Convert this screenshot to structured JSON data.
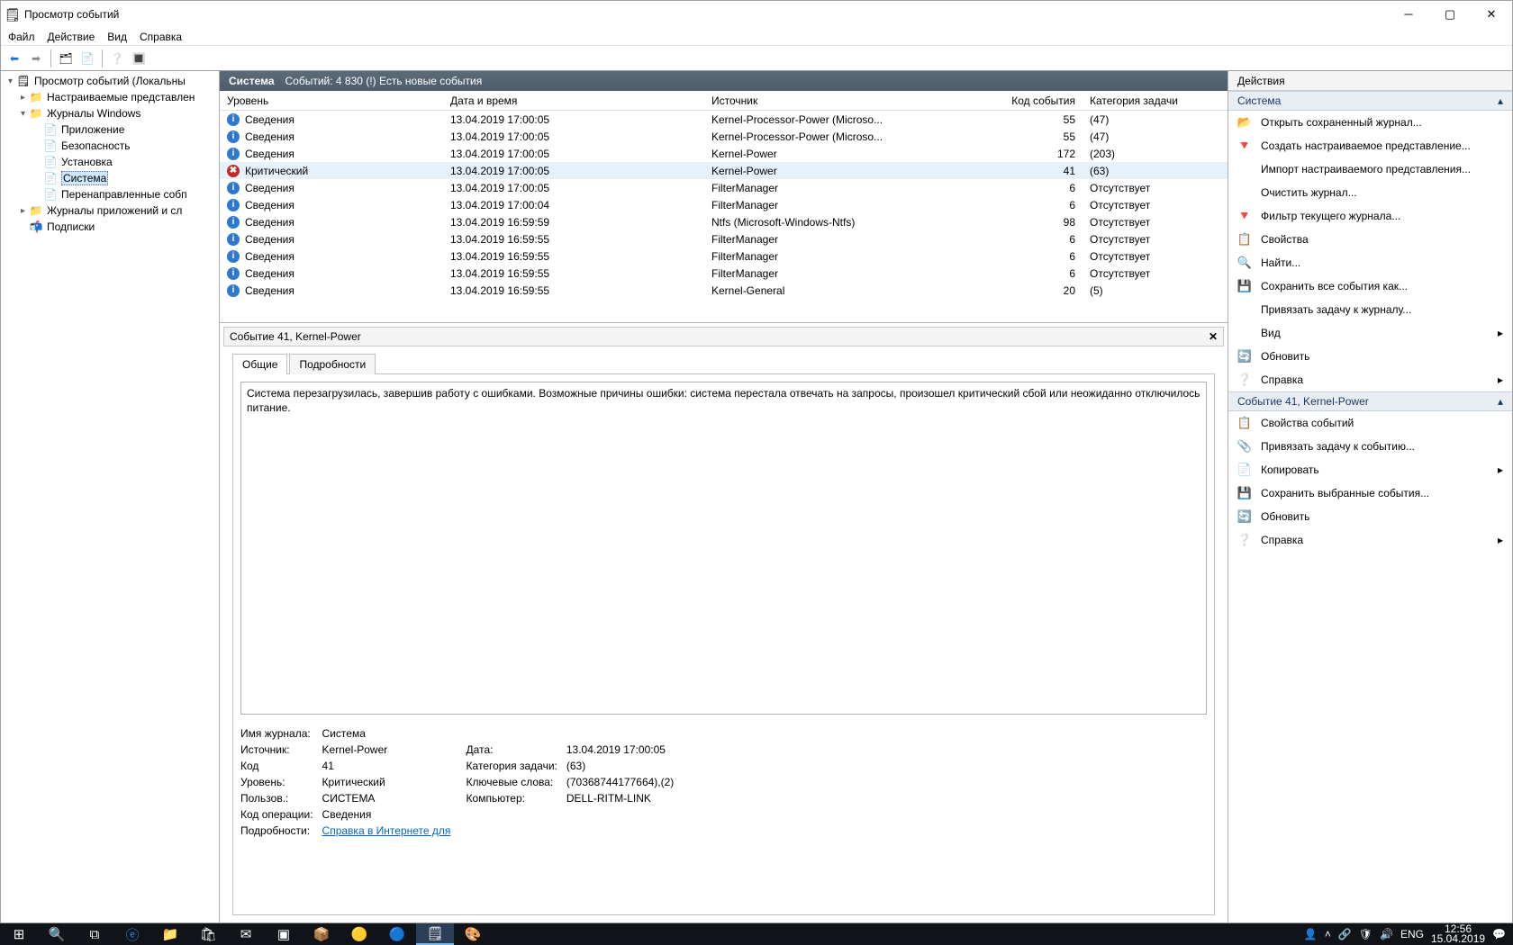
{
  "title": "Просмотр событий",
  "menu": [
    "Файл",
    "Действие",
    "Вид",
    "Справка"
  ],
  "tree": [
    {
      "d": 0,
      "exp": "▾",
      "icon": "🗒",
      "label": "Просмотр событий (Локальны"
    },
    {
      "d": 1,
      "exp": "▸",
      "icon": "📁",
      "label": "Настраиваемые представлен"
    },
    {
      "d": 1,
      "exp": "▾",
      "icon": "📁",
      "label": "Журналы Windows"
    },
    {
      "d": 2,
      "exp": "",
      "icon": "📄",
      "label": "Приложение"
    },
    {
      "d": 2,
      "exp": "",
      "icon": "📄",
      "label": "Безопасность"
    },
    {
      "d": 2,
      "exp": "",
      "icon": "📄",
      "label": "Установка"
    },
    {
      "d": 2,
      "exp": "",
      "icon": "📄",
      "label": "Система",
      "sel": true
    },
    {
      "d": 2,
      "exp": "",
      "icon": "📄",
      "label": "Перенаправленные собп"
    },
    {
      "d": 1,
      "exp": "▸",
      "icon": "📁",
      "label": "Журналы приложений и сл"
    },
    {
      "d": 1,
      "exp": "",
      "icon": "📬",
      "label": "Подписки"
    }
  ],
  "list_header": {
    "name": "Система",
    "info": "Событий: 4 830 (!) Есть новые события"
  },
  "columns": {
    "level": "Уровень",
    "date": "Дата и время",
    "src": "Источник",
    "code": "Код события",
    "cat": "Категория задачи"
  },
  "rows": [
    {
      "lv": "info",
      "level": "Сведения",
      "date": "13.04.2019 17:00:05",
      "src": "Kernel-Processor-Power (Microso...",
      "code": "55",
      "cat": "(47)"
    },
    {
      "lv": "info",
      "level": "Сведения",
      "date": "13.04.2019 17:00:05",
      "src": "Kernel-Processor-Power (Microso...",
      "code": "55",
      "cat": "(47)"
    },
    {
      "lv": "info",
      "level": "Сведения",
      "date": "13.04.2019 17:00:05",
      "src": "Kernel-Power",
      "code": "172",
      "cat": "(203)"
    },
    {
      "lv": "crit",
      "level": "Критический",
      "date": "13.04.2019 17:00:05",
      "src": "Kernel-Power",
      "code": "41",
      "cat": "(63)",
      "sel": true
    },
    {
      "lv": "info",
      "level": "Сведения",
      "date": "13.04.2019 17:00:05",
      "src": "FilterManager",
      "code": "6",
      "cat": "Отсутствует"
    },
    {
      "lv": "info",
      "level": "Сведения",
      "date": "13.04.2019 17:00:04",
      "src": "FilterManager",
      "code": "6",
      "cat": "Отсутствует"
    },
    {
      "lv": "info",
      "level": "Сведения",
      "date": "13.04.2019 16:59:59",
      "src": "Ntfs (Microsoft-Windows-Ntfs)",
      "code": "98",
      "cat": "Отсутствует"
    },
    {
      "lv": "info",
      "level": "Сведения",
      "date": "13.04.2019 16:59:55",
      "src": "FilterManager",
      "code": "6",
      "cat": "Отсутствует"
    },
    {
      "lv": "info",
      "level": "Сведения",
      "date": "13.04.2019 16:59:55",
      "src": "FilterManager",
      "code": "6",
      "cat": "Отсутствует"
    },
    {
      "lv": "info",
      "level": "Сведения",
      "date": "13.04.2019 16:59:55",
      "src": "FilterManager",
      "code": "6",
      "cat": "Отсутствует"
    },
    {
      "lv": "info",
      "level": "Сведения",
      "date": "13.04.2019 16:59:55",
      "src": "Kernel-General",
      "code": "20",
      "cat": "(5)"
    }
  ],
  "detail": {
    "title": "Событие 41, Kernel-Power",
    "tabs": [
      "Общие",
      "Подробности"
    ],
    "message": "Система перезагрузилась, завершив работу с ошибками. Возможные причины ошибки: система перестала отвечать на запросы, произошел критический сбой или неожиданно отключилось питание.",
    "fields": {
      "log_l": "Имя журнала:",
      "log_v": "Система",
      "src_l": "Источник:",
      "src_v": "Kernel-Power",
      "date_l": "Дата:",
      "date_v": "13.04.2019 17:00:05",
      "code_l": "Код",
      "code_v": "41",
      "cat_l": "Категория задачи:",
      "cat_v": "(63)",
      "lvl_l": "Уровень:",
      "lvl_v": "Критический",
      "kw_l": "Ключевые слова:",
      "kw_v": "(70368744177664),(2)",
      "usr_l": "Пользов.:",
      "usr_v": "СИСТЕМА",
      "comp_l": "Компьютер:",
      "comp_v": "DELL-RITM-LINK",
      "op_l": "Код операции:",
      "op_v": "Сведения",
      "more_l": "Подробности:",
      "more_v": "Справка в Интернете для "
    }
  },
  "actions": {
    "header": "Действия",
    "sec1": "Система",
    "items1": [
      {
        "i": "📂",
        "t": "Открыть сохраненный журнал..."
      },
      {
        "i": "🔻",
        "t": "Создать настраиваемое представление..."
      },
      {
        "i": "",
        "t": "Импорт настраиваемого представления..."
      },
      {
        "i": "",
        "t": "Очистить журнал..."
      },
      {
        "i": "🔻",
        "t": "Фильтр текущего журнала..."
      },
      {
        "i": "📋",
        "t": "Свойства"
      },
      {
        "i": "🔍",
        "t": "Найти..."
      },
      {
        "i": "💾",
        "t": "Сохранить все события как..."
      },
      {
        "i": "",
        "t": "Привязать задачу к журналу..."
      },
      {
        "i": "",
        "t": "Вид",
        "sub": true
      },
      {
        "i": "🔄",
        "t": "Обновить"
      },
      {
        "i": "❔",
        "t": "Справка",
        "sub": true
      }
    ],
    "sec2": "Событие 41, Kernel-Power",
    "items2": [
      {
        "i": "📋",
        "t": "Свойства событий"
      },
      {
        "i": "📎",
        "t": "Привязать задачу к событию..."
      },
      {
        "i": "📄",
        "t": "Копировать",
        "sub": true
      },
      {
        "i": "💾",
        "t": "Сохранить выбранные события..."
      },
      {
        "i": "🔄",
        "t": "Обновить"
      },
      {
        "i": "❔",
        "t": "Справка",
        "sub": true
      }
    ]
  },
  "tray": {
    "lang": "ENG",
    "time": "12:56",
    "date": "15.04.2019"
  }
}
